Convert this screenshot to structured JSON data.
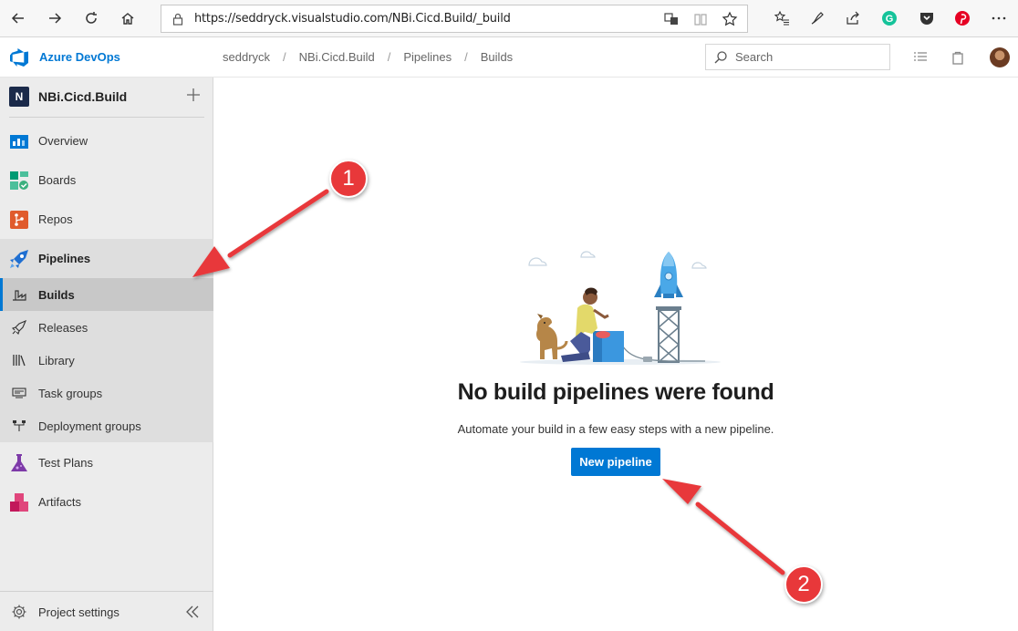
{
  "browser": {
    "url": "https://seddryck.visualstudio.com/NBi.Cicd.Build/_build"
  },
  "header": {
    "brand": "Azure DevOps",
    "breadcrumb": [
      "seddryck",
      "NBi.Cicd.Build",
      "Pipelines",
      "Builds"
    ],
    "search_placeholder": "Search"
  },
  "sidebar": {
    "project_initial": "N",
    "project_name": "NBi.Cicd.Build",
    "items": [
      {
        "label": "Overview",
        "icon": "overview-icon"
      },
      {
        "label": "Boards",
        "icon": "boards-icon"
      },
      {
        "label": "Repos",
        "icon": "repos-icon"
      },
      {
        "label": "Pipelines",
        "icon": "pipelines-icon"
      },
      {
        "label": "Test Plans",
        "icon": "test-plans-icon"
      },
      {
        "label": "Artifacts",
        "icon": "artifacts-icon"
      }
    ],
    "pipelines_subitems": [
      {
        "label": "Builds",
        "icon": "builds-icon",
        "active": true
      },
      {
        "label": "Releases",
        "icon": "releases-icon"
      },
      {
        "label": "Library",
        "icon": "library-icon"
      },
      {
        "label": "Task groups",
        "icon": "task-groups-icon"
      },
      {
        "label": "Deployment groups",
        "icon": "deployment-groups-icon"
      }
    ],
    "settings_label": "Project settings"
  },
  "main": {
    "empty_title": "No build pipelines were found",
    "empty_description": "Automate your build in a few easy steps with a new pipeline.",
    "new_pipeline_label": "New pipeline"
  },
  "annotations": {
    "marker_1": "1",
    "marker_2": "2",
    "color": "#e8383a"
  },
  "colors": {
    "accent": "#0078d4"
  }
}
